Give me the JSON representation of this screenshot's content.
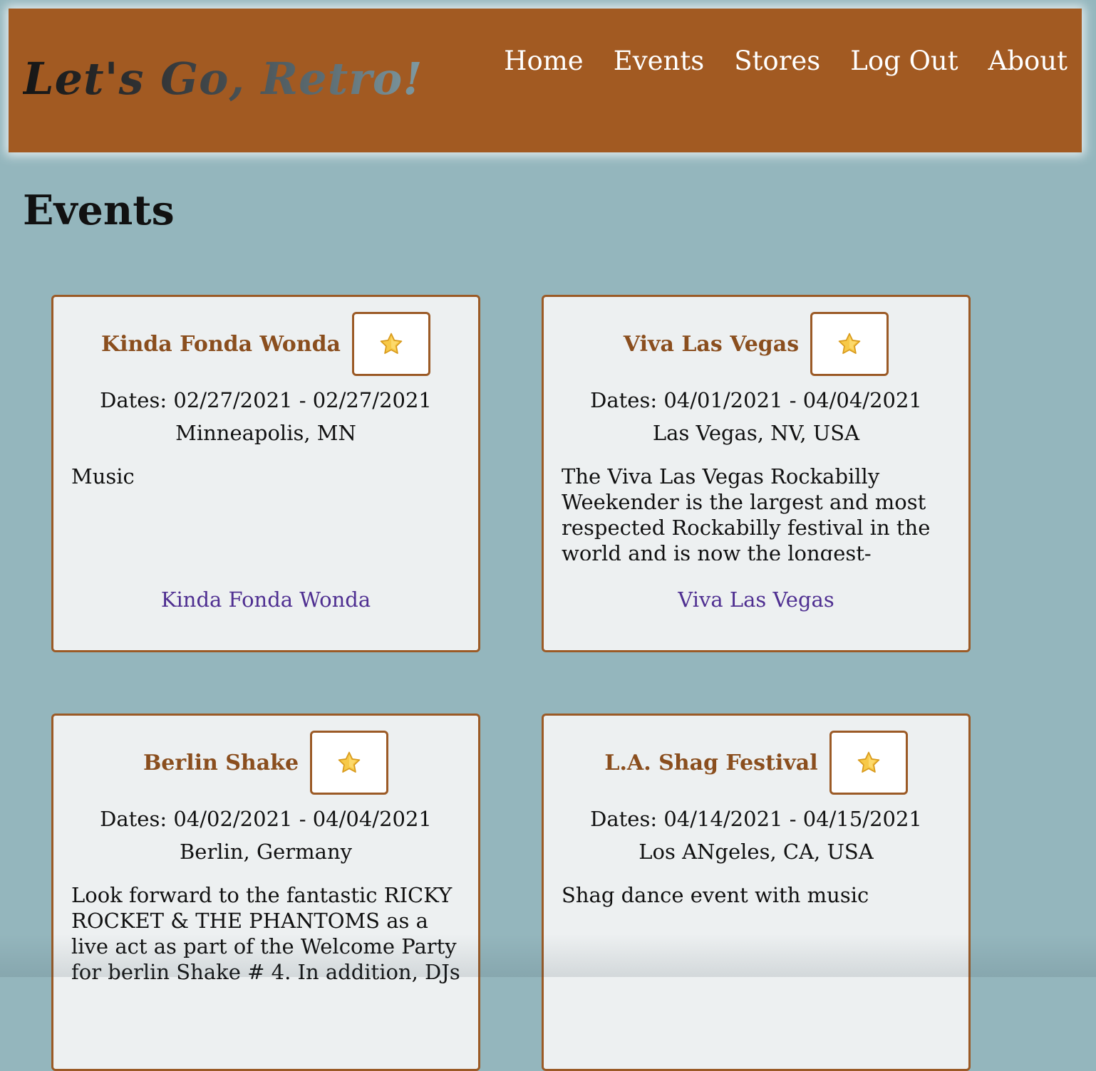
{
  "header": {
    "logo": "Let's Go, Retro!",
    "nav": [
      "Home",
      "Events",
      "Stores",
      "Log Out",
      "About"
    ]
  },
  "page": {
    "title": "Events"
  },
  "events": [
    {
      "title": "Kinda Fonda Wonda",
      "dates": "Dates: 02/27/2021 - 02/27/2021",
      "location": "Minneapolis, MN",
      "description": "Music",
      "link": "Kinda Fonda Wonda"
    },
    {
      "title": "Viva Las Vegas",
      "dates": "Dates: 04/01/2021 - 04/04/2021",
      "location": "Las Vegas, NV, USA",
      "description": "The Viva Las Vegas Rockabilly Weekender is the largest and most respected Rockabilly festival in the world and is now the longest-running music festival in Las Vegas",
      "link": "Viva Las Vegas"
    },
    {
      "title": "Berlin Shake",
      "dates": "Dates: 04/02/2021 - 04/04/2021",
      "location": "Berlin, Germany",
      "description": "Look forward to the fantastic RICKY ROCKET & THE PHANTOMS as a live act as part of the Welcome Party for berlin Shake # 4. In addition, DJs Craig",
      "link": ""
    },
    {
      "title": "L.A. Shag Festival",
      "dates": "Dates: 04/14/2021 - 04/15/2021",
      "location": "Los ANgeles, CA, USA",
      "description": "Shag dance event with music",
      "link": ""
    }
  ],
  "icons": {
    "favorite": "star-icon"
  },
  "colors": {
    "background": "#94b6bd",
    "header": "#a25a22",
    "card_border": "#9b5a26",
    "card_title": "#8a4e1e",
    "link": "#4f2f91"
  }
}
